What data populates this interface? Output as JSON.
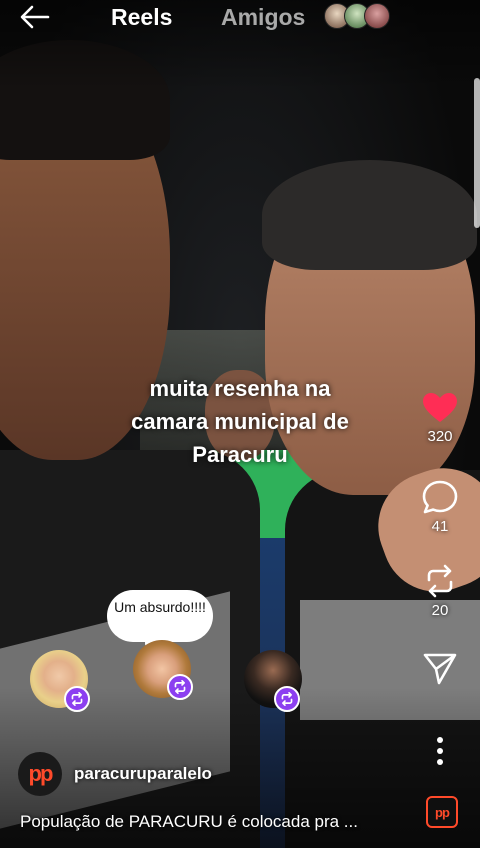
{
  "header": {
    "back_icon": "arrow-left-icon",
    "tabs": [
      {
        "label": "Reels",
        "active": true
      },
      {
        "label": "Amigos",
        "active": false
      }
    ]
  },
  "overlay_caption": [
    "muita resenha na",
    "camara municipal de",
    "Paracuru"
  ],
  "actions": {
    "like": {
      "icon": "heart-icon",
      "count": "320",
      "liked": true,
      "color": "#ff2d55"
    },
    "comment": {
      "icon": "comment-icon",
      "count": "41"
    },
    "remix": {
      "icon": "repost-icon",
      "count": "20"
    },
    "share": {
      "icon": "send-icon"
    },
    "more": {
      "icon": "more-vertical-icon"
    }
  },
  "friend_activity": {
    "bubble_text": "Um absurdo!!!!",
    "badge_icon": "repost-icon",
    "badge_color": "#8c3ff0"
  },
  "account": {
    "logo_text": "pp",
    "username": "paracuruparalelo",
    "brand_color": "#ff4a2a"
  },
  "description": "População de PARACURU é colocada pra ...",
  "audio_thumb_text": "pp"
}
